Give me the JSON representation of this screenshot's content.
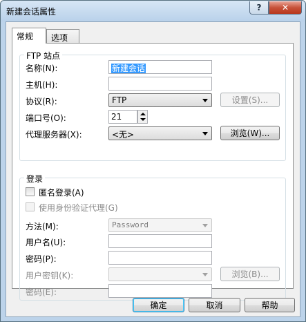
{
  "window": {
    "title": "新建会话属性"
  },
  "titlebar": {
    "help_glyph": "?",
    "close_glyph": "✕"
  },
  "tabs": [
    {
      "label": "常规",
      "active": true
    },
    {
      "label": "选项",
      "active": false
    }
  ],
  "ftp_group": {
    "title": "FTP 站点",
    "name_label": "名称(N):",
    "name_value": "新建会话",
    "host_label": "主机(H):",
    "host_value": "",
    "protocol_label": "协议(R):",
    "protocol_value": "FTP",
    "settings_button": "设置(S)...",
    "port_label": "端口号(O):",
    "port_value": "21",
    "proxy_label": "代理服务器(X):",
    "proxy_value": "<无>",
    "browse_button": "浏览(W)..."
  },
  "login_group": {
    "title": "登录",
    "anonymous_label": "匿名登录(A)",
    "auth_agent_label": "使用身份验证代理(G)",
    "method_label": "方法(M):",
    "method_value": "Password",
    "username_label": "用户名(U):",
    "username_value": "",
    "password_label": "密码(P):",
    "password_value": "",
    "userkey_label": "用户密钥(K):",
    "userkey_value": "",
    "browse_button": "浏览(B)...",
    "passphrase_label": "密码(E):",
    "passphrase_value": ""
  },
  "footer": {
    "ok_button": "确定",
    "cancel_button": "取消",
    "help_button": "帮助"
  }
}
